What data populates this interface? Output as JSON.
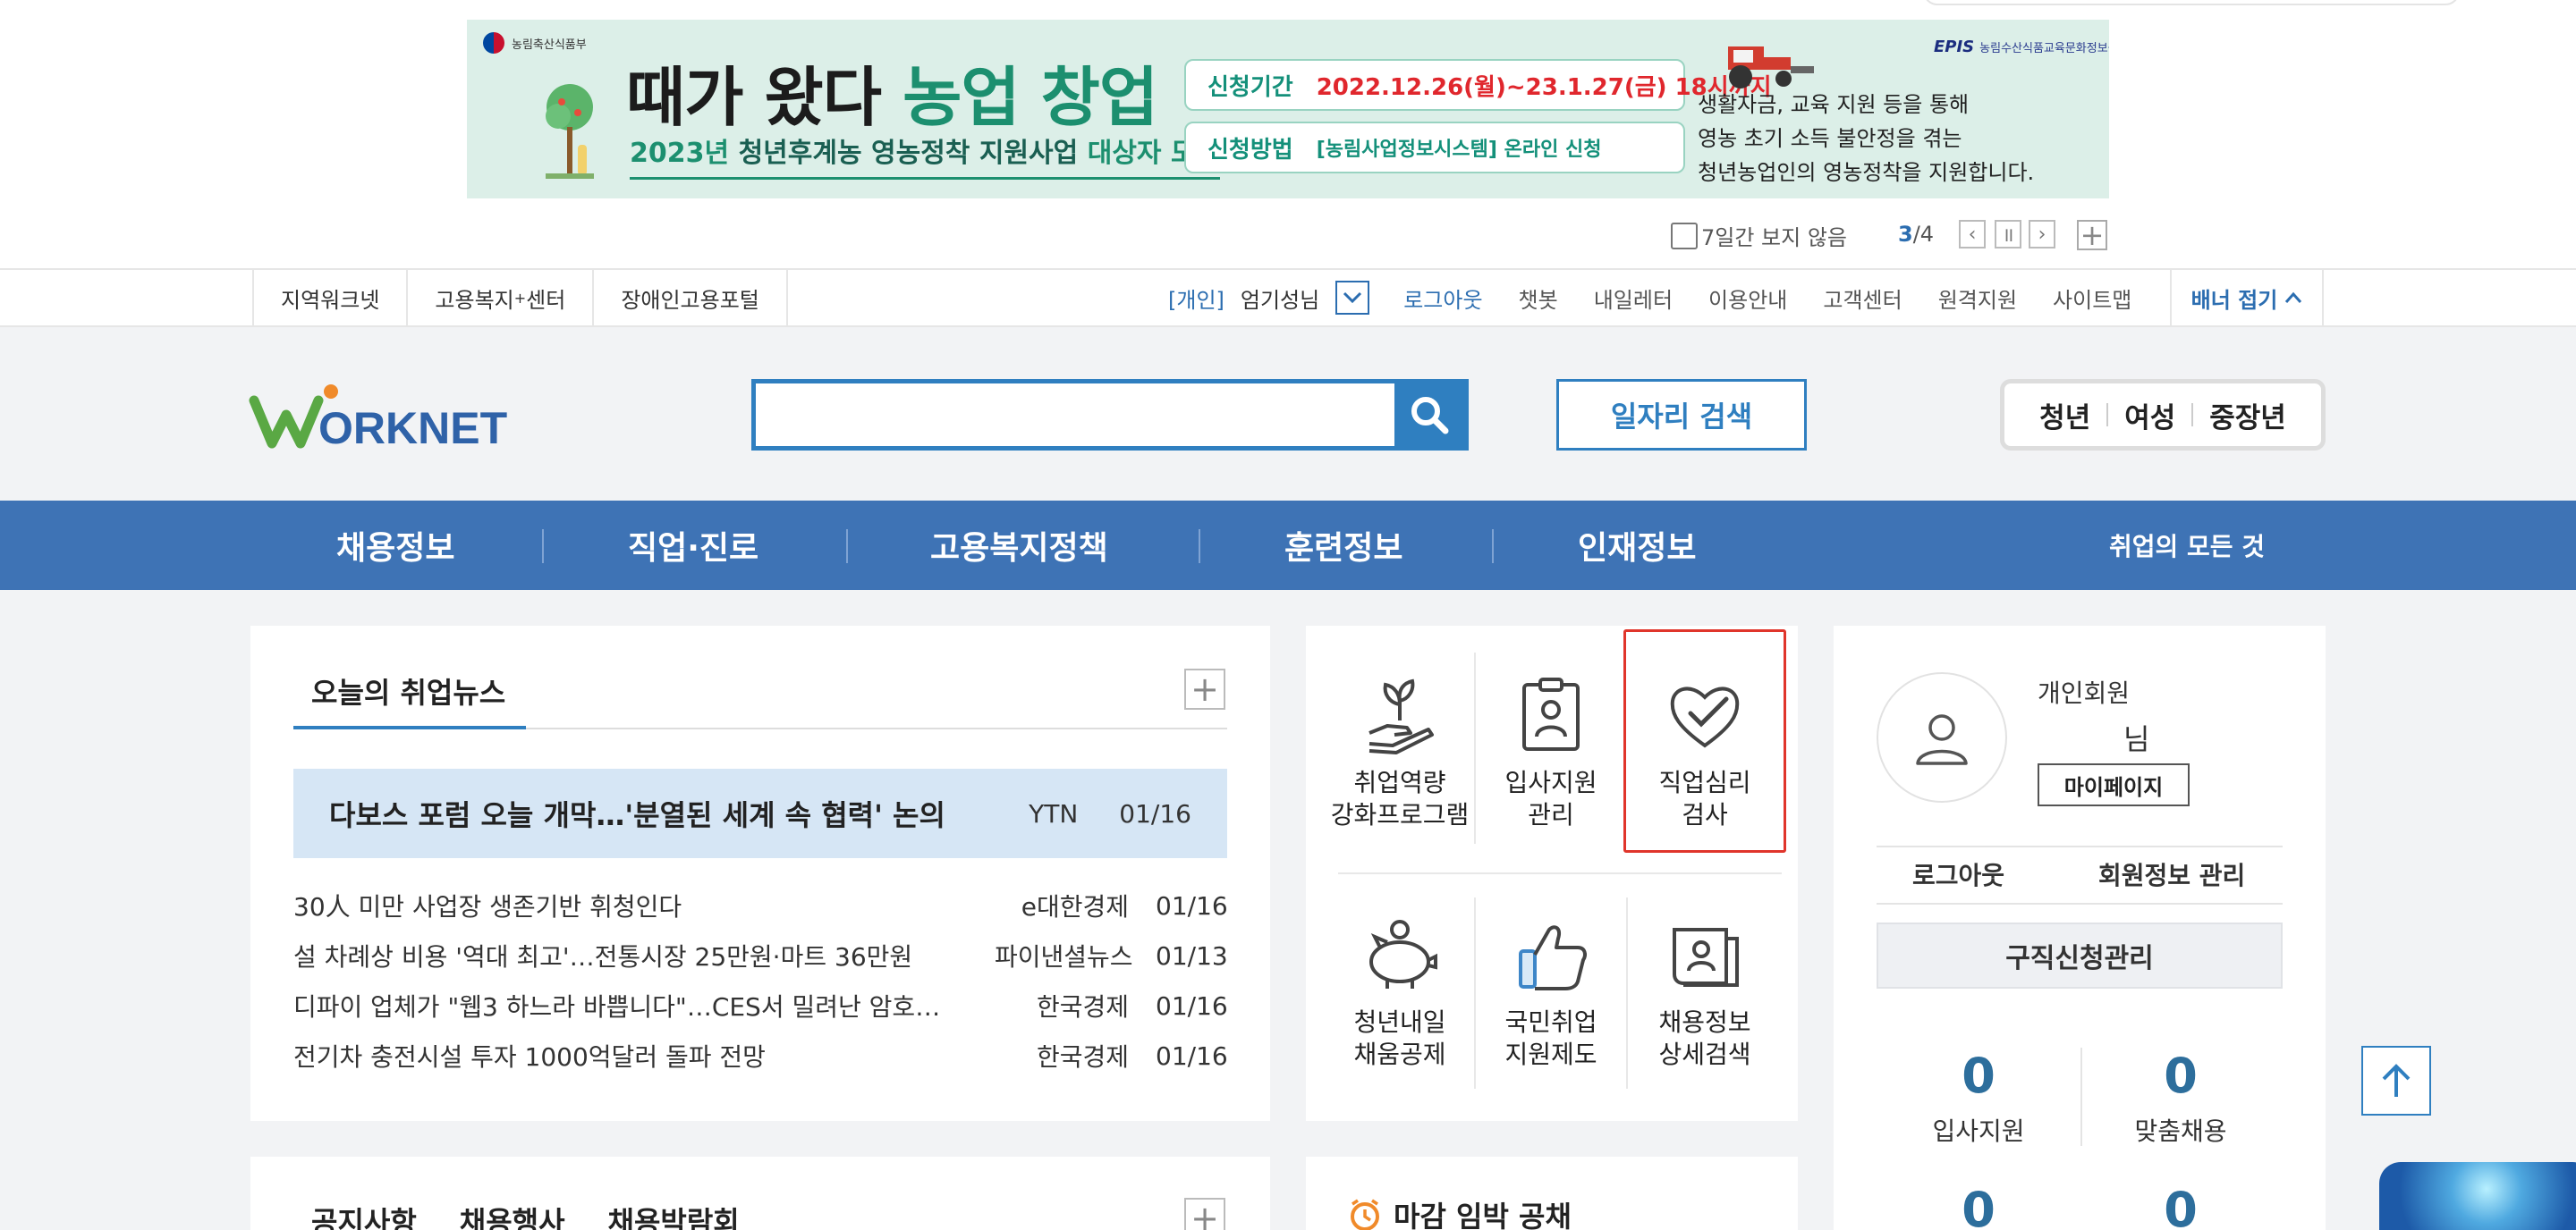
{
  "banner": {
    "ministry": "농림축산식품부",
    "headline_black": "때가 왔다",
    "headline_green": "농업 창업",
    "subline_year": "2023년",
    "subline_bold": "청년후계농 영농정착 지원사업",
    "subline_rest": "대상자 모집",
    "period_label": "신청기간",
    "period_value": "2022.12.26(월)~23.1.27(금) 18시까지",
    "method_label": "신청방법",
    "method_value": "[농림사업정보시스템] 온라인 신청",
    "org_logo": "EPIS",
    "org_name": "농림수산식품교육문화정보원",
    "desc_line1": "생활자금, 교육 지원 등을 통해",
    "desc_line2": "영농 초기 소득 불안정을 겪는",
    "desc_line3": "청년농업인의 영농정착을 지원합니다.",
    "hide_week": "7일간 보지 않음",
    "current_page": "3",
    "total_pages": "/4"
  },
  "util": {
    "sites": [
      "지역워크넷",
      "고용복지",
      "장애인고용포털"
    ],
    "site2_sup": "+",
    "site2_suffix": "센터",
    "member_tag": "[개인]",
    "user_name": "엄기성님",
    "logout": "로그아웃",
    "links": [
      "챗봇",
      "내일레터",
      "이용안내",
      "고객센터",
      "원격지원",
      "사이트맵"
    ],
    "fold_banner": "배너 접기"
  },
  "header": {
    "logo_w": "W",
    "logo_rest": "ORKNET",
    "search_placeholder": "",
    "job_search": "일자리 검색",
    "age_tabs": [
      "청년",
      "여성",
      "중장년"
    ]
  },
  "gnb": {
    "items": [
      "채용정보",
      "직업·진로",
      "고용복지정책",
      "훈련정보",
      "인재정보"
    ],
    "all": "취업의 모든 것"
  },
  "news": {
    "title": "오늘의 취업뉴스",
    "headline": {
      "title": "다보스 포럼 오늘 개막…'분열된 세계 속 협력' 논의",
      "source": "YTN",
      "date": "01/16"
    },
    "items": [
      {
        "title": "30人 미만 사업장 생존기반 휘청인다",
        "source": "e대한경제",
        "date": "01/16"
      },
      {
        "title": "설 차례상 비용 '역대 최고'…전통시장 25만원·마트 36만원",
        "source": "파이낸셜뉴스",
        "date": "01/13"
      },
      {
        "title": "디파이 업체가 \"웹3 하느라 바쁩니다\"…CES서 밀려난 암호…",
        "source": "한국경제",
        "date": "01/16"
      },
      {
        "title": "전기차 충전시설 투자 1000억달러 돌파 전망",
        "source": "한국경제",
        "date": "01/16"
      }
    ]
  },
  "services": [
    {
      "line1": "취업역량",
      "line2": "강화프로그램"
    },
    {
      "line1": "입사지원",
      "line2": "관리"
    },
    {
      "line1": "직업심리",
      "line2": "검사"
    },
    {
      "line1": "청년내일",
      "line2": "채움공제"
    },
    {
      "line1": "국민취업",
      "line2": "지원제도"
    },
    {
      "line1": "채용정보",
      "line2": "상세검색"
    }
  ],
  "member": {
    "type": "개인회원",
    "nim": "님",
    "mypage": "마이페이지",
    "logout": "로그아웃",
    "info_manage": "회원정보 관리",
    "job_apply_manage": "구직신청관리",
    "stats": [
      {
        "value": "0",
        "label": "입사지원"
      },
      {
        "value": "0",
        "label": "맞춤채용"
      },
      {
        "value": "0"
      },
      {
        "value": "0"
      }
    ]
  },
  "bottom": {
    "notice_tabs": [
      "공지사항",
      "채용행사",
      "채용박람회"
    ],
    "deadline": "마감 임박 공채"
  },
  "colors": {
    "primary": "#3e73b5",
    "accent": "#2f7fc0",
    "highlight": "#e0352b",
    "banner_bg": "#dcefe8"
  }
}
